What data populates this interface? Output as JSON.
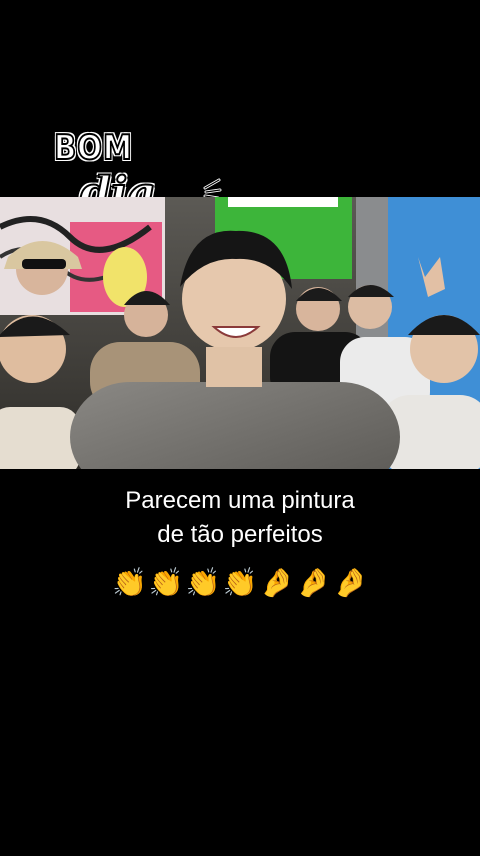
{
  "sticker": {
    "line1": "BOM",
    "line2": "dia",
    "sparkle_icon": "sparkle-icon"
  },
  "photo": {
    "description_icon": "group-selfie-photo"
  },
  "caption": {
    "line1": "Parecem uma pintura",
    "line2": "de tão perfeitos"
  },
  "emojis": {
    "clap1": "👏",
    "clap2": "👏",
    "clap3": "👏",
    "clap4": "👏",
    "pinch1": "🤌",
    "pinch2": "🤌",
    "pinch3": "🤌"
  },
  "colors": {
    "background": "#000000",
    "caption_text": "#ffffff",
    "emoji_yellow": "#f2b233"
  }
}
